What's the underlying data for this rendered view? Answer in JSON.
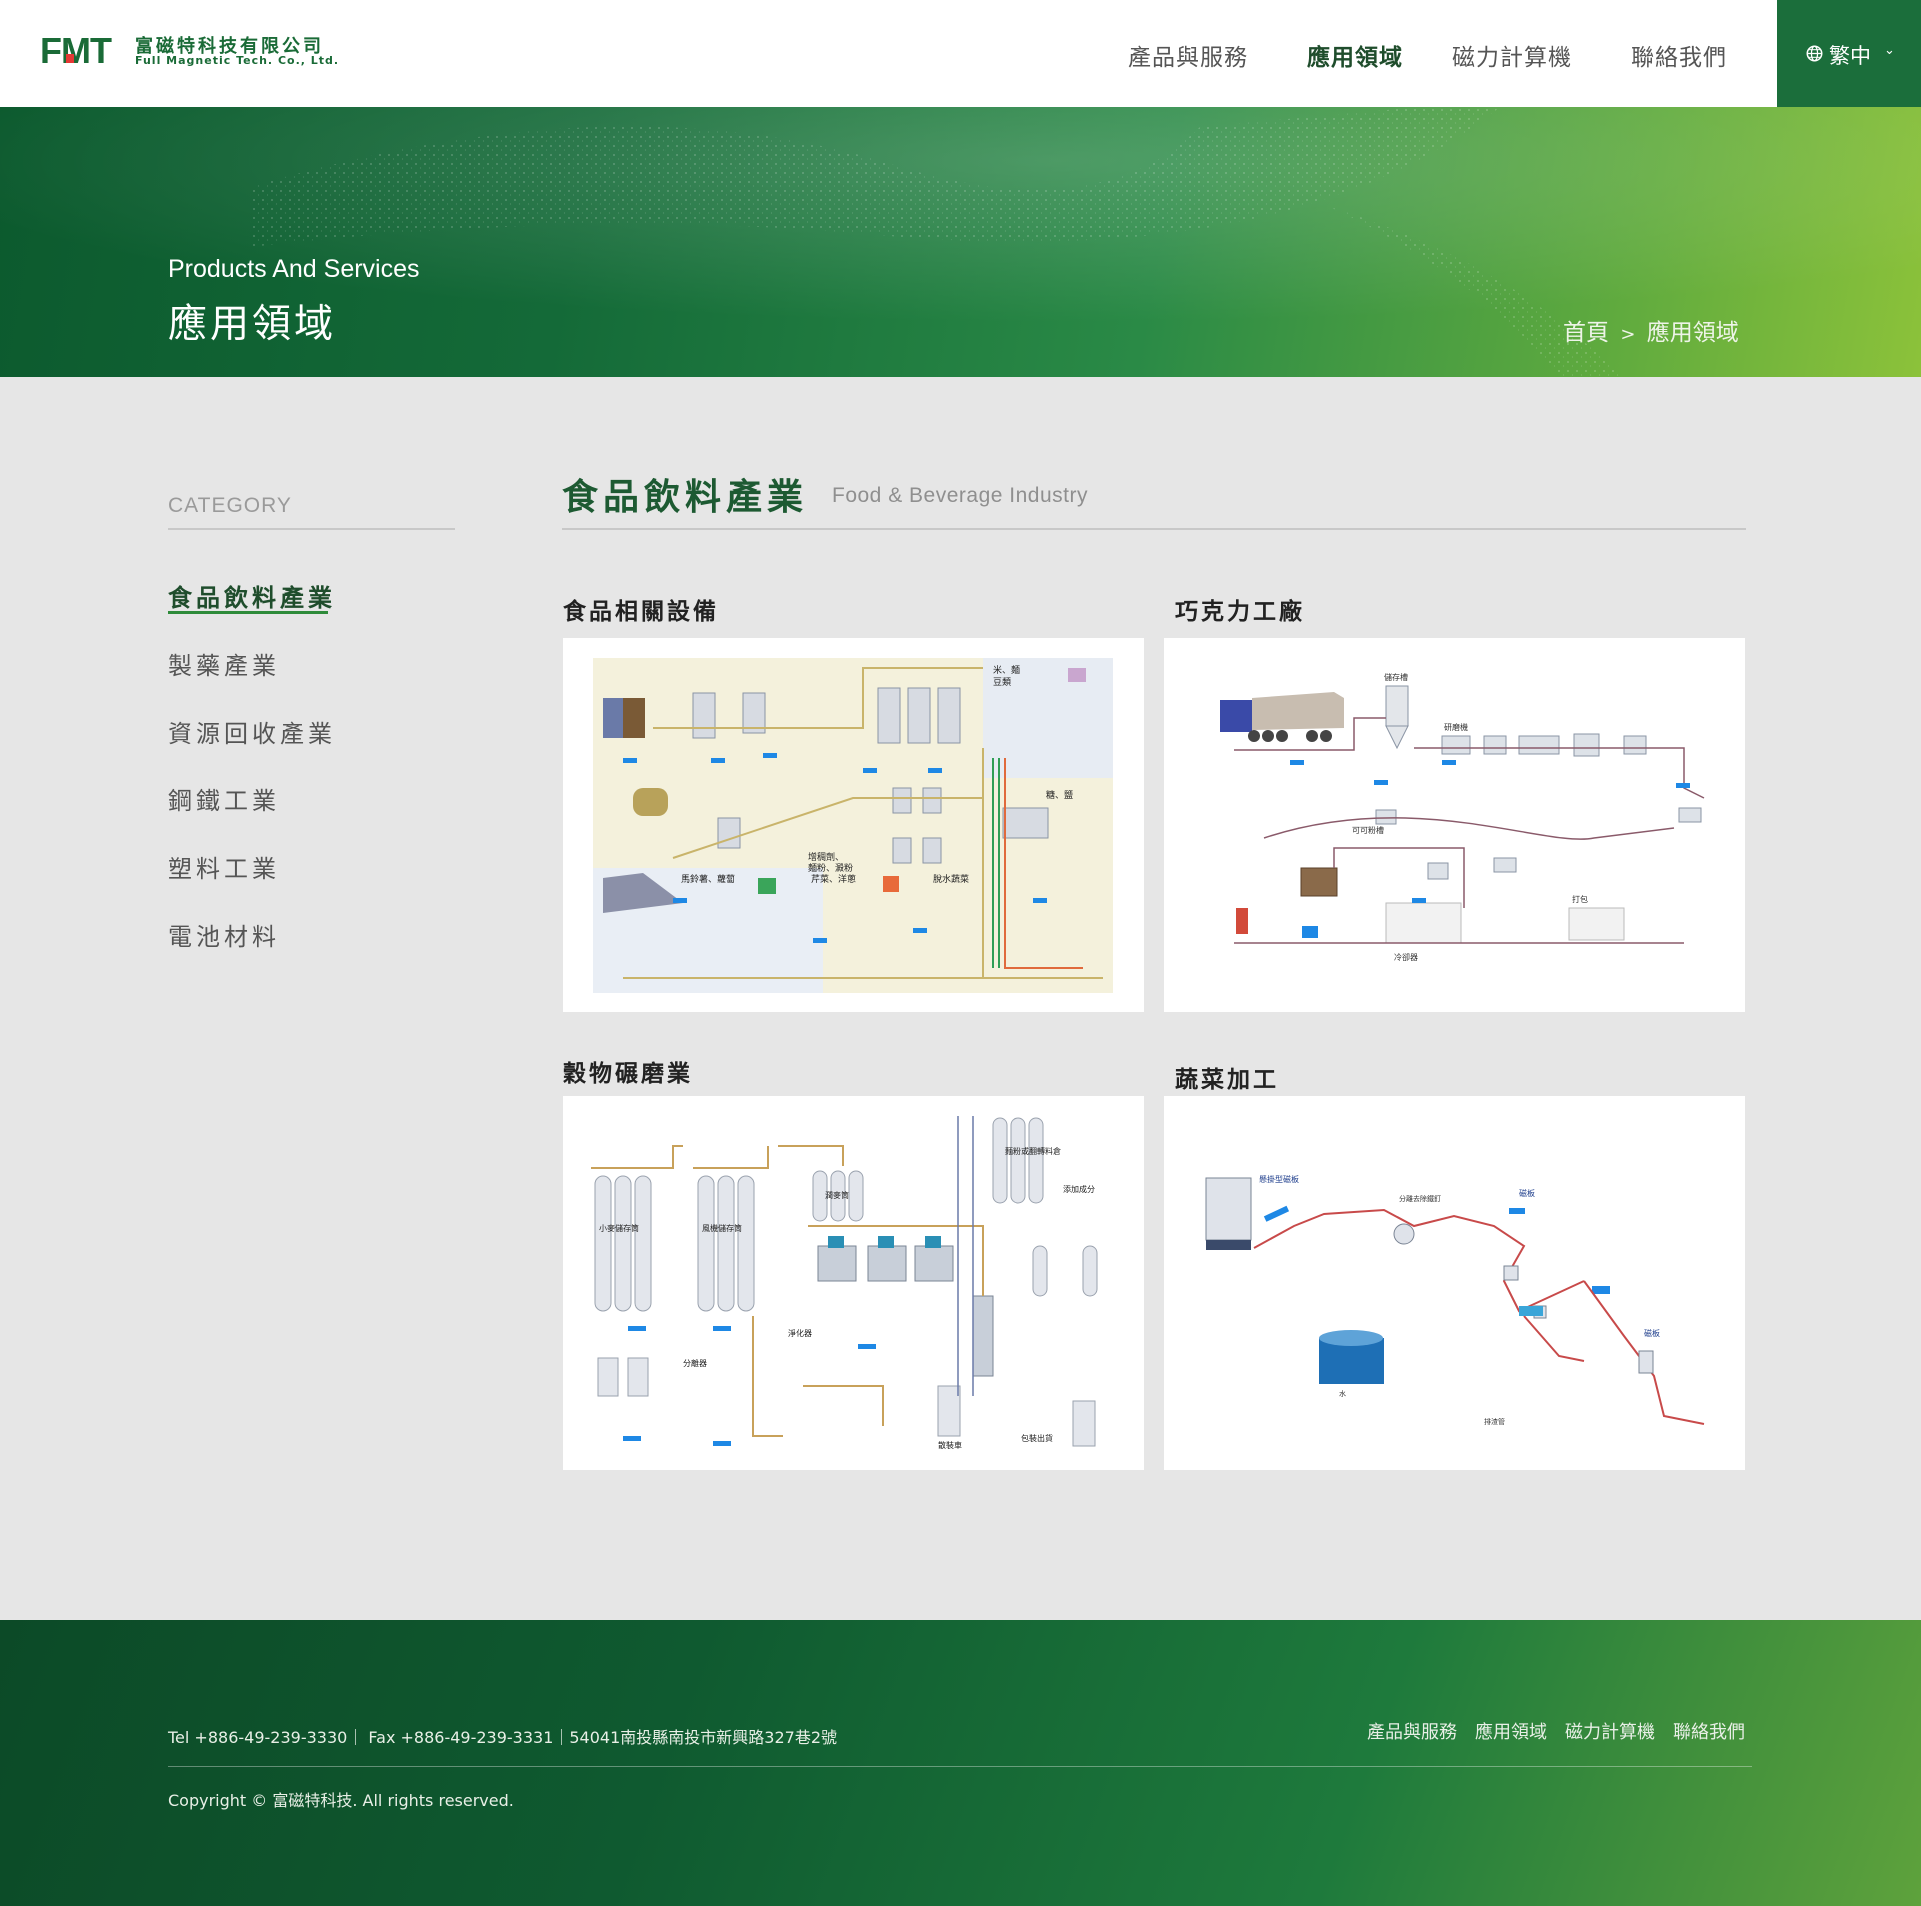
{
  "brand": {
    "logo_mark": "FMT",
    "name_cn": "富磁特科技有限公司",
    "name_en": "Full Magnetic Tech. Co., Ltd.",
    "primary_color": "#1b6e3b",
    "accent_color": "#8cc23a"
  },
  "nav": {
    "items": [
      "產品與服務",
      "應用領域",
      "磁力計算機",
      "聯絡我們"
    ],
    "active_index": 1,
    "language": "繁中",
    "language_icon": "globe-icon"
  },
  "banner": {
    "subtitle_en": "Products And Services",
    "title_cn": "應用領域",
    "breadcrumb_home": "首頁",
    "breadcrumb_sep": ">",
    "breadcrumb_current": "應用領域"
  },
  "sidebar": {
    "heading": "CATEGORY",
    "items": [
      "食品飲料產業",
      "製藥產業",
      "資源回收產業",
      "鋼鐵工業",
      "塑料工業",
      "電池材料"
    ],
    "active_index": 0
  },
  "main": {
    "title_cn": "食品飲料產業",
    "title_en": "Food & Beverage Industry",
    "cards": [
      {
        "title": "食品相關設備",
        "diagram": "food-equipment-process-diagram"
      },
      {
        "title": "巧克力工廠",
        "diagram": "chocolate-factory-process-diagram"
      },
      {
        "title": "穀物碾磨業",
        "diagram": "grain-milling-process-diagram"
      },
      {
        "title": "蔬菜加工",
        "diagram": "vegetable-processing-diagram"
      }
    ]
  },
  "footer": {
    "contact": "Tel +886-49-239-3330｜ Fax +886-49-239-3331｜54041南投縣南投市新興路327巷2號",
    "nav": [
      "產品與服務",
      "應用領域",
      "磁力計算機",
      "聯絡我們"
    ],
    "copyright": "Copyright © 富磁特科技. All rights reserved."
  }
}
